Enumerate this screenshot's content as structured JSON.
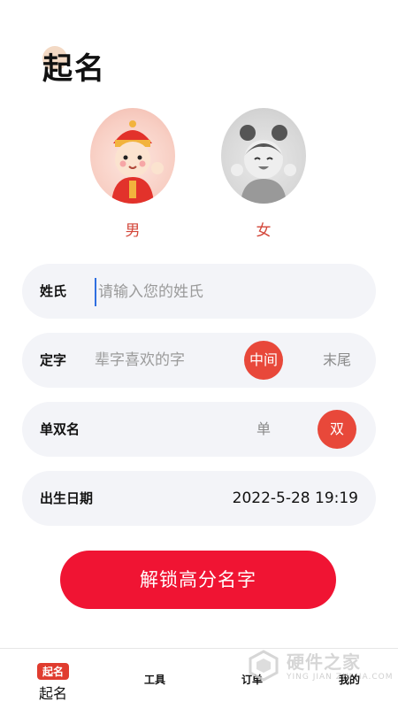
{
  "header": {
    "title": "起名"
  },
  "gender": {
    "male": {
      "label": "男",
      "selected": true
    },
    "female": {
      "label": "女",
      "selected": false
    }
  },
  "form": {
    "surname": {
      "label": "姓氏",
      "placeholder": "请输入您的姓氏",
      "value": ""
    },
    "fixed_char": {
      "label": "定字",
      "placeholder": "辈字喜欢的字",
      "options": [
        "中间",
        "末尾"
      ],
      "selected": "中间"
    },
    "name_length": {
      "label": "单双名",
      "options": [
        "单",
        "双"
      ],
      "selected": "双"
    },
    "birth": {
      "label": "出生日期",
      "value": "2022-5-28 19:19"
    }
  },
  "cta": {
    "label": "解锁高分名字"
  },
  "tabbar": {
    "items": [
      {
        "badge": "起名",
        "label": "起名",
        "active": true
      },
      {
        "label": "工具",
        "active": false
      },
      {
        "label": "订单",
        "active": false
      },
      {
        "label": "我的",
        "active": false
      }
    ]
  },
  "watermark": {
    "name": "硬件之家",
    "sub": "YING JIAN ZHI JIA.COM"
  },
  "colors": {
    "accent": "#e8483a",
    "cta": "#f01433",
    "field_bg": "#f3f4f8"
  }
}
